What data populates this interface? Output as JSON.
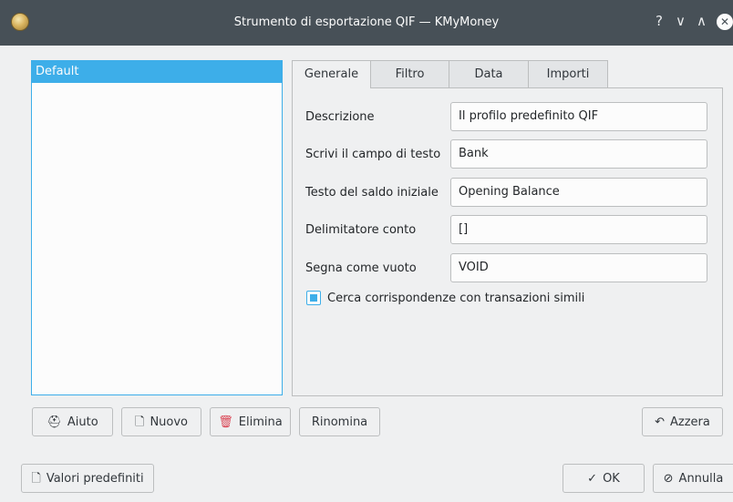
{
  "window": {
    "title": "Strumento di esportazione QIF — KMyMoney",
    "help_glyph": "?",
    "minimize_glyph": "∨",
    "maximize_glyph": "∧",
    "close_glyph": "✕"
  },
  "profiles": {
    "items": [
      {
        "label": "Default",
        "selected": true
      }
    ]
  },
  "tabs": [
    {
      "label": "Generale",
      "active": true
    },
    {
      "label": "Filtro",
      "active": false
    },
    {
      "label": "Data",
      "active": false
    },
    {
      "label": "Importi",
      "active": false
    }
  ],
  "general": {
    "fields": [
      {
        "label": "Descrizione",
        "value": "Il profilo predefinito QIF"
      },
      {
        "label": "Scrivi il campo di testo",
        "value": "Bank"
      },
      {
        "label": "Testo del saldo iniziale",
        "value": "Opening Balance"
      },
      {
        "label": "Delimitatore conto",
        "value": "[]"
      },
      {
        "label": "Segna come vuoto",
        "value": "VOID"
      }
    ],
    "match_checkbox": {
      "label": "Cerca corrispondenze con transazioni simili",
      "checked": true
    }
  },
  "profile_buttons": {
    "help": "Aiuto",
    "new": "Nuovo",
    "delete": "Elimina",
    "rename": "Rinomina",
    "reset": "Azzera"
  },
  "footer": {
    "defaults": "Valori predefiniti",
    "ok": "OK",
    "cancel": "Annulla"
  },
  "colors": {
    "accent": "#3daee9",
    "titlebar": "#475057",
    "delete_icon": "#da4453"
  }
}
